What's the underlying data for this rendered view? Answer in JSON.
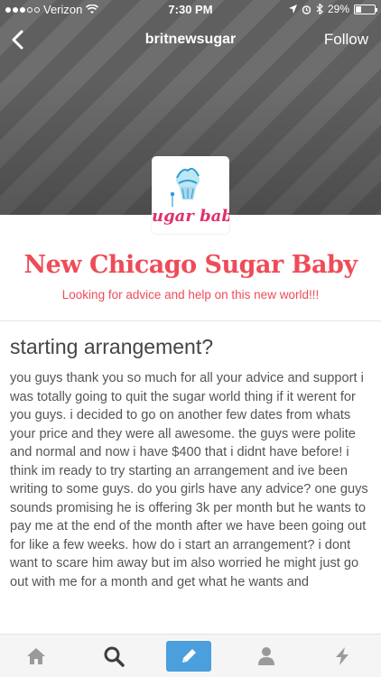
{
  "status_bar": {
    "carrier": "Verizon",
    "time": "7:30 PM",
    "battery": "29%"
  },
  "nav": {
    "title": "britnewsugar",
    "follow_label": "Follow"
  },
  "blog": {
    "avatar_text": "ugar bab",
    "title": "New Chicago Sugar Baby",
    "description": "Looking for advice and help on this new world!!!"
  },
  "post": {
    "title": "starting arrangement?",
    "body": "you guys thank you so much for all your advice and support i was totally going to quit the sugar world thing if it werent for you guys. i decided to go on another few dates from whats your price and they were all awesome. the guys were polite and normal and now i have $400 that i didnt have before! i think im ready to try starting an arrangement and ive been writing to some guys. do you girls have any advice? one guys sounds promising he is offering 3k per month but he wants to pay me at the end of the month after we have been going out for like a few weeks. how do i start an arrangement? i dont want to scare him away but im also worried he might just go out with me for a month and get what he wants and"
  },
  "tabbar": {
    "items": [
      {
        "icon": "home-icon"
      },
      {
        "icon": "search-icon"
      },
      {
        "icon": "compose-icon"
      },
      {
        "icon": "account-icon"
      },
      {
        "icon": "activity-icon"
      }
    ]
  },
  "colors": {
    "accent": "#ee4c58",
    "compose": "#4a9fdc",
    "tab_icon": "#999999"
  }
}
